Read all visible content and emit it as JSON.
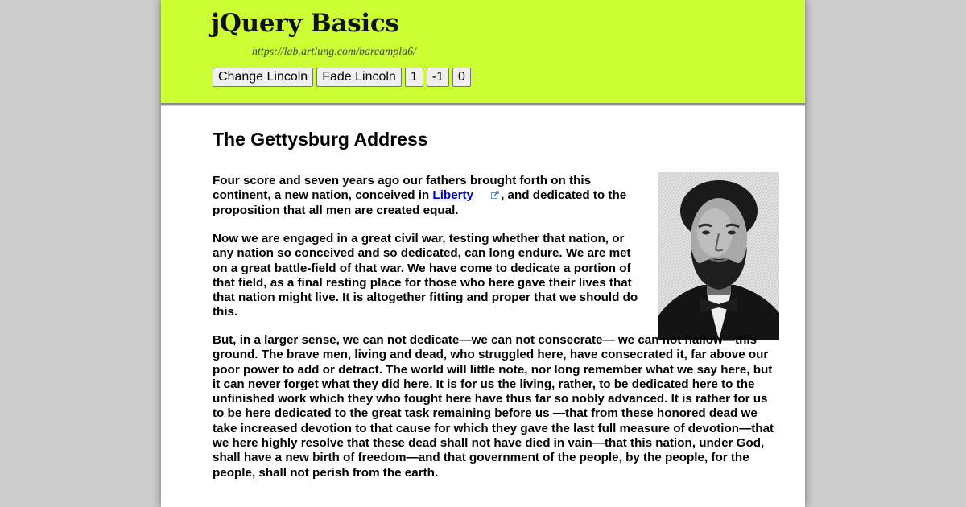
{
  "header": {
    "title": "jQuery Basics",
    "url": "https://lab.artlung.com/barcampla6/",
    "background_color": "#ccff33"
  },
  "controls": {
    "change_lincoln": "Change Lincoln",
    "fade_lincoln": "Fade Lincoln",
    "plus_one": "1",
    "minus_one": "-1",
    "zero": "0"
  },
  "article": {
    "title": "The Gettysburg Address",
    "p1_before": "Four score and seven years ago our fathers brought forth on this continent, a new nation, conceived in ",
    "p1_link": "Liberty",
    "p1_after": ", and dedicated to the proposition that all men are created equal.",
    "p2": "Now we are engaged in a great civil war, testing whether that nation, or any nation so conceived and so dedicated, can long endure. We are met on a great battle-field of that war. We have come to dedicate a portion of that field, as a final resting place for those who here gave their lives that that nation might live. It is altogether fitting and proper that we should do this.",
    "p3": "But, in a larger sense, we can not dedicate—we can not consecrate— we can not hallow—this ground. The brave men, living and dead, who struggled here, have consecrated it, far above our poor power to add or detract. The world will little note, nor long remember what we say here, but it can never forget what they did here. It is for us the living, rather, to be dedicated here to the unfinished work which they who fought here have thus far so nobly advanced. It is rather for us to be here dedicated to the great task remaining before us —that from these honored dead we take increased devotion to that cause for which they gave the last full measure of devotion—that we here highly resolve that these dead shall not have died in vain—that this nation, under God, shall have a new birth of freedom—and that government of the people, by the people, for the people, shall not perish from the earth."
  },
  "icons": {
    "external_link": "external-link-icon",
    "portrait": "lincoln-portrait"
  },
  "colors": {
    "link": "#0000cc",
    "page_background": "#cccccc"
  }
}
